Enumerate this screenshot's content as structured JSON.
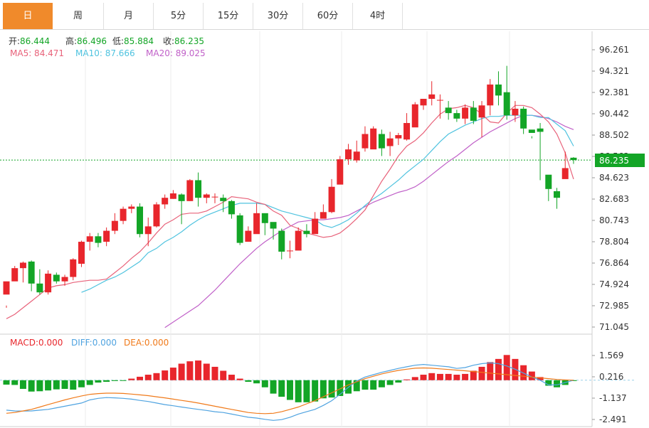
{
  "tabs": [
    {
      "label": "日",
      "active": true
    },
    {
      "label": "周",
      "active": false
    },
    {
      "label": "月",
      "active": false
    },
    {
      "label": "5分",
      "active": false
    },
    {
      "label": "15分",
      "active": false
    },
    {
      "label": "30分",
      "active": false
    },
    {
      "label": "60分",
      "active": false
    },
    {
      "label": "4时",
      "active": false
    }
  ],
  "info": {
    "open_label": "开:",
    "open": "86.444",
    "high_label": "高:",
    "high": "86.496",
    "low_label": "低:",
    "low": "85.884",
    "close_label": "收:",
    "close": "86.235"
  },
  "ma": {
    "ma5": "MA5: 84.471",
    "ma10": "MA10: 87.666",
    "ma20": "MA20: 89.025"
  },
  "macd_info": {
    "macd": "MACD:0.000",
    "diff": "DIFF:0.000",
    "dea": "DEA:0.000"
  },
  "price_axis": [
    "96.261",
    "94.321",
    "92.381",
    "90.442",
    "88.502",
    "86.562",
    "84.623",
    "82.683",
    "80.743",
    "78.804",
    "76.864",
    "74.924",
    "72.985",
    "71.045"
  ],
  "current_price_label": "86.235",
  "macd_axis": [
    "1.569",
    "0.216",
    "-1.137",
    "-2.491"
  ],
  "colors": {
    "up": "#e8262c",
    "down": "#13a526",
    "ma5": "#e8627a",
    "ma10": "#4fc3df",
    "ma20": "#c060c8",
    "diff": "#4fa3e0",
    "dea": "#f07a1a",
    "tab_active": "#f08a2b"
  },
  "chart_data": {
    "type": "candlestick",
    "candles": [
      [
        74.0,
        75.2,
        73.0,
        72.8
      ],
      [
        75.2,
        76.4,
        75.4,
        76.6
      ],
      [
        76.4,
        76.9,
        75.1,
        77.0
      ],
      [
        77.0,
        75.0,
        74.3,
        77.1
      ],
      [
        75.0,
        74.2,
        74.0,
        76.3
      ],
      [
        74.2,
        75.9,
        74.0,
        76.2
      ],
      [
        75.8,
        75.2,
        75.0,
        76.0
      ],
      [
        75.2,
        75.6,
        74.8,
        75.8
      ],
      [
        75.6,
        77.2,
        75.3,
        77.3
      ],
      [
        76.8,
        78.8,
        76.5,
        78.9
      ],
      [
        78.8,
        79.3,
        78.0,
        79.6
      ],
      [
        79.3,
        78.7,
        78.3,
        79.6
      ],
      [
        78.8,
        79.8,
        78.4,
        80.1
      ],
      [
        79.8,
        80.7,
        79.5,
        81.4
      ],
      [
        80.7,
        81.8,
        80.4,
        82.0
      ],
      [
        81.8,
        82.0,
        81.4,
        82.2
      ],
      [
        82.0,
        79.5,
        79.2,
        82.3
      ],
      [
        79.5,
        80.2,
        78.4,
        81.0
      ],
      [
        80.2,
        82.2,
        80.1,
        82.4
      ],
      [
        82.2,
        82.8,
        81.8,
        83.1
      ],
      [
        82.7,
        83.2,
        82.7,
        83.5
      ],
      [
        83.1,
        82.5,
        80.4,
        83.2
      ],
      [
        82.5,
        84.4,
        82.5,
        84.5
      ],
      [
        84.4,
        82.8,
        82.0,
        85.1
      ],
      [
        82.8,
        83.1,
        82.3,
        83.2
      ],
      [
        82.9,
        82.9,
        82.3,
        83.2
      ],
      [
        82.8,
        82.5,
        81.5,
        83.1
      ],
      [
        82.5,
        81.3,
        80.9,
        82.6
      ],
      [
        81.2,
        78.7,
        78.5,
        81.4
      ],
      [
        78.8,
        79.8,
        79.0,
        80.2
      ],
      [
        79.5,
        81.4,
        79.8,
        82.3
      ],
      [
        81.4,
        80.5,
        79.4,
        80.9
      ],
      [
        80.6,
        80.0,
        79.0,
        80.2
      ],
      [
        79.8,
        77.9,
        77.2,
        80.0
      ],
      [
        78.0,
        78.0,
        77.3,
        78.9
      ],
      [
        78.0,
        79.8,
        78.2,
        80.1
      ],
      [
        79.8,
        79.5,
        79.2,
        80.4
      ],
      [
        79.5,
        80.9,
        80.2,
        81.5
      ],
      [
        80.9,
        81.5,
        81.1,
        82.2
      ],
      [
        81.5,
        83.8,
        81.4,
        84.5
      ],
      [
        84.0,
        86.3,
        84.4,
        86.6
      ],
      [
        86.3,
        87.2,
        85.8,
        87.7
      ],
      [
        86.2,
        87.0,
        86.0,
        88.0
      ],
      [
        87.3,
        88.6,
        87.0,
        89.3
      ],
      [
        87.2,
        89.1,
        88.0,
        89.3
      ],
      [
        88.6,
        87.3,
        86.6,
        89.0
      ],
      [
        87.5,
        88.2,
        86.6,
        88.8
      ],
      [
        88.2,
        88.5,
        87.6,
        88.7
      ],
      [
        88.1,
        89.6,
        88.0,
        90.5
      ],
      [
        89.2,
        91.3,
        89.3,
        91.5
      ],
      [
        91.2,
        91.8,
        90.8,
        91.8
      ],
      [
        91.8,
        92.2,
        91.2,
        93.4
      ],
      [
        91.7,
        91.7,
        90.0,
        92.2
      ],
      [
        91.0,
        90.5,
        89.9,
        91.6
      ],
      [
        90.5,
        90.0,
        89.7,
        90.8
      ],
      [
        90.0,
        91.0,
        89.5,
        91.3
      ],
      [
        91.0,
        89.8,
        89.5,
        91.6
      ],
      [
        90.1,
        91.2,
        88.3,
        91.6
      ],
      [
        91.2,
        93.1,
        90.3,
        93.6
      ],
      [
        93.1,
        92.1,
        91.2,
        94.3
      ],
      [
        92.4,
        90.3,
        89.9,
        94.8
      ],
      [
        90.3,
        90.9,
        89.7,
        91.6
      ],
      [
        90.9,
        89.1,
        88.6,
        91.1
      ],
      [
        89.0,
        88.7,
        88.2,
        88.4
      ],
      [
        89.1,
        88.8,
        84.4,
        89.6
      ],
      [
        84.9,
        83.6,
        82.5,
        84.3
      ],
      [
        83.4,
        82.8,
        81.8,
        83.7
      ],
      [
        84.5,
        85.5,
        84.6,
        87.0
      ],
      [
        86.444,
        86.235,
        85.884,
        86.496
      ]
    ],
    "ma5": [
      71.8,
      72.2,
      72.8,
      73.4,
      74.0,
      74.6,
      74.8,
      74.9,
      75.1,
      75.2,
      75.3,
      75.3,
      75.4,
      76.0,
      76.6,
      77.3,
      77.9,
      78.7,
      79.6,
      80.4,
      80.8,
      81.3,
      81.4,
      81.4,
      81.6,
      82.0,
      82.4,
      82.9,
      82.8,
      82.7,
      82.4,
      82.2,
      81.6,
      81.2,
      80.3,
      80.0,
      79.6,
      79.4,
      79.2,
      79.3,
      79.6,
      80.2,
      80.9,
      81.7,
      83.0,
      84.3,
      85.4,
      86.6,
      87.5,
      88.0,
      88.7,
      89.6,
      90.4,
      90.9,
      91.0,
      91.2,
      91.0,
      90.4,
      89.7,
      89.6,
      90.5,
      91.2,
      91.2,
      91.0,
      90.4,
      89.7,
      88.6,
      86.9,
      84.5
    ],
    "ma10": [
      null,
      null,
      null,
      null,
      null,
      null,
      null,
      null,
      null,
      74.2,
      74.5,
      74.9,
      75.3,
      75.6,
      76.0,
      76.5,
      77.0,
      77.8,
      78.2,
      78.8,
      79.2,
      79.7,
      80.3,
      80.8,
      81.2,
      81.5,
      81.8,
      82.1,
      82.3,
      82.3,
      82.3,
      82.2,
      81.9,
      81.6,
      81.4,
      81.2,
      81.0,
      80.8,
      80.3,
      80.1,
      80.4,
      80.8,
      81.4,
      82.1,
      82.7,
      83.2,
      83.8,
      84.4,
      85.1,
      85.7,
      86.3,
      87.1,
      87.9,
      88.6,
      89.0,
      89.4,
      89.7,
      90.0,
      90.2,
      90.2,
      90.3,
      90.3,
      90.3,
      90.3,
      90.1,
      90.1,
      89.5,
      88.9,
      87.5
    ],
    "ma20": [
      null,
      null,
      null,
      null,
      null,
      null,
      null,
      null,
      null,
      null,
      null,
      null,
      null,
      null,
      null,
      null,
      null,
      null,
      null,
      71.0,
      71.5,
      72.0,
      72.5,
      73.0,
      73.7,
      74.4,
      75.2,
      76.0,
      76.8,
      77.5,
      78.2,
      78.8,
      79.3,
      79.8,
      80.2,
      80.6,
      80.7,
      80.8,
      80.8,
      80.9,
      81.0,
      81.2,
      81.6,
      82.0,
      82.4,
      82.7,
      83.0,
      83.3,
      83.5,
      83.8,
      84.3,
      84.9,
      85.5,
      86.1,
      86.6,
      87.2,
      87.8,
      88.3,
      88.8,
      89.2,
      89.6,
      90.0,
      90.3,
      90.3,
      90.2,
      90.0,
      89.7,
      89.3,
      89.0
    ],
    "macd_hist": [
      -0.28,
      -0.3,
      -0.55,
      -0.72,
      -0.7,
      -0.65,
      -0.58,
      -0.55,
      -0.6,
      -0.45,
      -0.3,
      -0.15,
      -0.1,
      -0.05,
      -0.02,
      0.1,
      0.22,
      0.35,
      0.45,
      0.62,
      0.8,
      1.05,
      1.2,
      1.25,
      1.05,
      0.85,
      0.6,
      0.35,
      0.1,
      -0.1,
      -0.2,
      -0.45,
      -0.85,
      -1.05,
      -1.25,
      -1.4,
      -1.4,
      -1.35,
      -1.15,
      -1.1,
      -1.0,
      -0.85,
      -0.7,
      -0.6,
      -0.6,
      -0.45,
      -0.3,
      -0.15,
      0.05,
      0.2,
      0.35,
      0.45,
      0.4,
      0.4,
      0.35,
      0.4,
      0.6,
      0.85,
      1.15,
      1.35,
      1.6,
      1.35,
      0.95,
      0.55,
      0.2,
      -0.35,
      -0.45,
      -0.3,
      -0.05
    ],
    "diff": [
      -1.9,
      -1.95,
      -1.96,
      -1.95,
      -1.9,
      -1.85,
      -1.75,
      -1.65,
      -1.55,
      -1.45,
      -1.25,
      -1.15,
      -1.1,
      -1.12,
      -1.15,
      -1.2,
      -1.28,
      -1.35,
      -1.45,
      -1.55,
      -1.62,
      -1.7,
      -1.78,
      -1.85,
      -1.92,
      -2.0,
      -2.05,
      -2.15,
      -2.25,
      -2.35,
      -2.4,
      -2.48,
      -2.55,
      -2.5,
      -2.35,
      -2.15,
      -2.0,
      -1.85,
      -1.6,
      -1.3,
      -0.9,
      -0.45,
      -0.05,
      0.2,
      0.35,
      0.5,
      0.62,
      0.75,
      0.85,
      0.95,
      1.0,
      0.95,
      0.9,
      0.85,
      0.75,
      0.8,
      0.95,
      1.05,
      1.1,
      1.05,
      0.9,
      0.7,
      0.45,
      0.2,
      0.0,
      -0.3,
      -0.3,
      -0.15,
      0.0
    ],
    "dea": [
      -2.1,
      -2.05,
      -1.95,
      -1.85,
      -1.7,
      -1.55,
      -1.4,
      -1.25,
      -1.12,
      -1.0,
      -0.9,
      -0.85,
      -0.82,
      -0.82,
      -0.84,
      -0.88,
      -0.93,
      -0.98,
      -1.05,
      -1.12,
      -1.2,
      -1.28,
      -1.36,
      -1.45,
      -1.55,
      -1.65,
      -1.75,
      -1.85,
      -1.95,
      -2.05,
      -2.1,
      -2.12,
      -2.1,
      -2.0,
      -1.85,
      -1.7,
      -1.5,
      -1.3,
      -1.05,
      -0.8,
      -0.55,
      -0.3,
      -0.1,
      0.1,
      0.25,
      0.4,
      0.52,
      0.62,
      0.7,
      0.76,
      0.78,
      0.76,
      0.72,
      0.68,
      0.64,
      0.6,
      0.55,
      0.5,
      0.45,
      0.4,
      0.35,
      0.3,
      0.25,
      0.2,
      0.15,
      0.1,
      0.05,
      0.02,
      0.0
    ],
    "ylim": [
      71.045,
      96.261
    ],
    "macd_ylim": [
      -2.491,
      1.569
    ]
  }
}
